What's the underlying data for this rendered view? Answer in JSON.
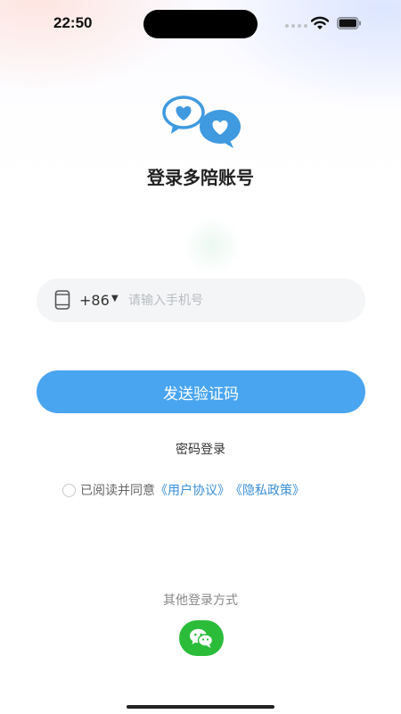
{
  "status_bar": {
    "time": "22:50",
    "icons": [
      "signal-dots-icon",
      "wifi-icon",
      "battery-icon"
    ]
  },
  "header": {
    "logo_icon": "chat-hearts-icon",
    "title": "登录多陪账号"
  },
  "login_form": {
    "phone_icon": "phone-icon",
    "country_code": "+86",
    "phone_placeholder": "请输入手机号",
    "phone_value": "",
    "send_code_label": "发送验证码",
    "password_login_label": "密码登录"
  },
  "agreement": {
    "checked": false,
    "prefix": "已阅读并同意",
    "user_agreement": "《用户协议》",
    "privacy_policy": "《隐私政策》"
  },
  "other_login": {
    "label": "其他登录方式",
    "wechat_icon": "wechat-icon"
  },
  "colors": {
    "primary": "#4aa5f0",
    "link": "#3a8fd8",
    "wechat": "#2bbd3a",
    "logo_blue": "#3f9ae0"
  }
}
